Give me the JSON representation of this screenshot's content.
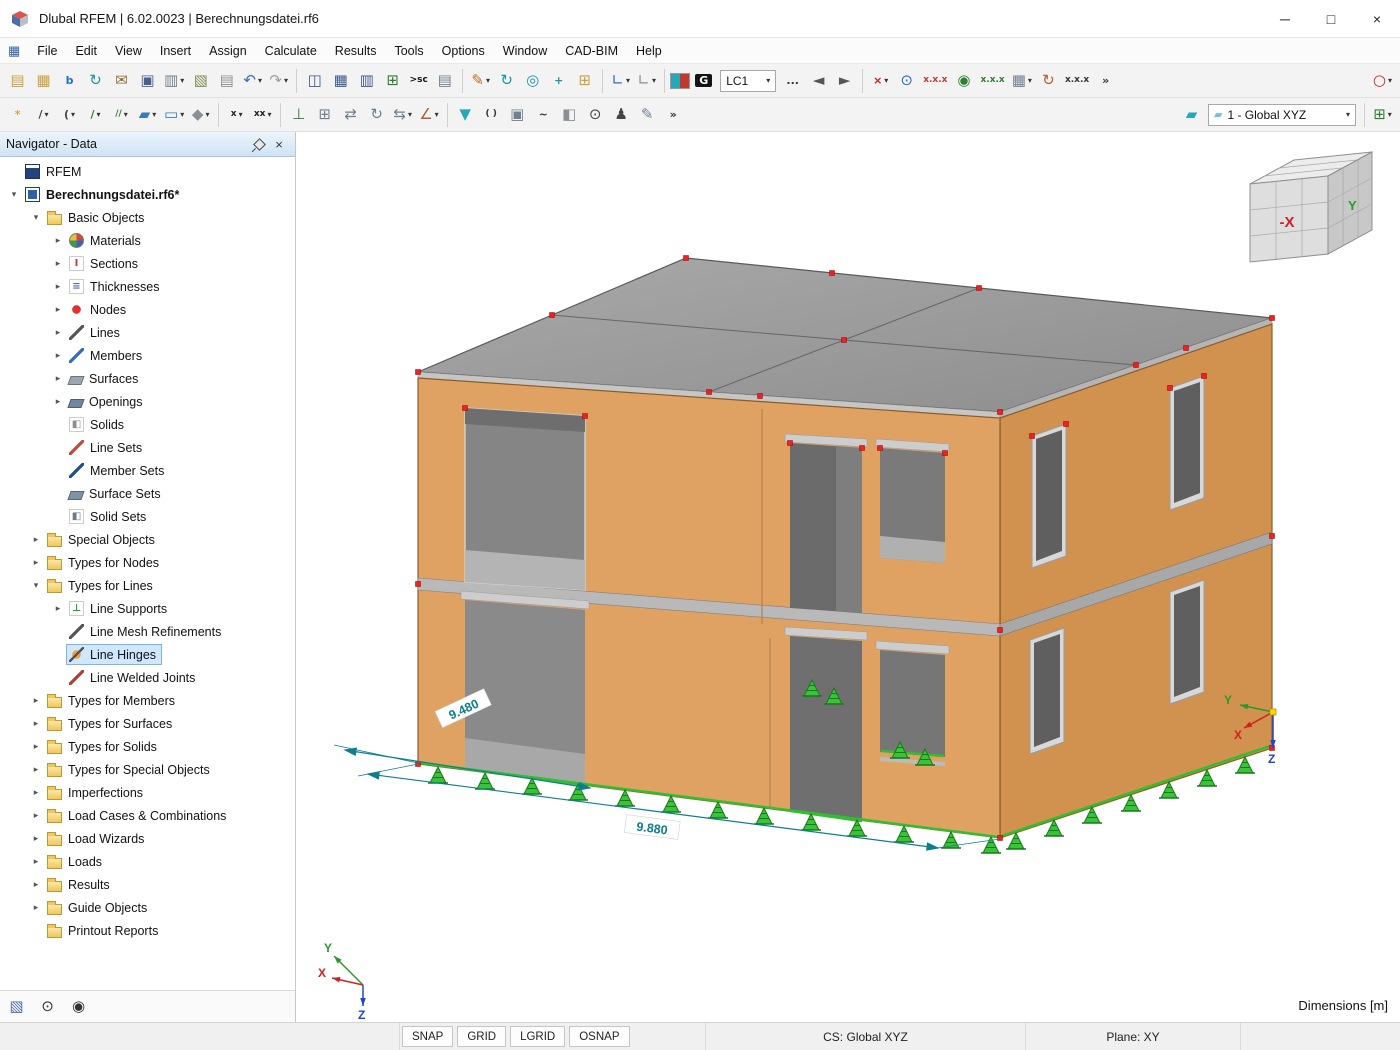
{
  "ui": {
    "caret": "▾",
    "chevron_right": "▸",
    "chevron_down": "▾"
  },
  "window": {
    "title": "Dlubal RFEM | 6.02.0023 | Berechnungsdatei.rf6",
    "minimize": "─",
    "maximize": "□",
    "close": "×"
  },
  "menu": {
    "items": [
      "File",
      "Edit",
      "View",
      "Insert",
      "Assign",
      "Calculate",
      "Results",
      "Tools",
      "Options",
      "Window",
      "CAD-BIM",
      "Help"
    ]
  },
  "toolbar1": {
    "items": [
      {
        "name": "new-model-button",
        "glyph": "▤",
        "color": "#c9a23d"
      },
      {
        "name": "open-model-button",
        "glyph": "▦",
        "color": "#c9a23d"
      },
      {
        "name": "bim-link-button",
        "glyph": "b",
        "text": true,
        "color": "#1f6fd0",
        "bold": true
      },
      {
        "name": "refresh-model-button",
        "glyph": "↻",
        "color": "#1b94a8"
      },
      {
        "name": "send-model-button",
        "glyph": "✉",
        "color": "#8a6d2f"
      },
      {
        "name": "save-button",
        "glyph": "▣",
        "color": "#47618f"
      },
      {
        "name": "print-button",
        "glyph": "▥",
        "color": "#6f7f8f",
        "caret": true
      },
      {
        "name": "export-report-button",
        "glyph": "▧",
        "color": "#7b8c4a"
      },
      {
        "name": "printout-report-button",
        "glyph": "▤",
        "color": "#8a8f96"
      },
      {
        "name": "undo-button",
        "glyph": "↶",
        "color": "#2f6fbf",
        "caret": true
      },
      {
        "name": "redo-button",
        "glyph": "↷",
        "color": "#9aa0a6",
        "caret": true
      },
      {
        "sep": true
      },
      {
        "name": "navigator-toggle-button",
        "glyph": "◫",
        "color": "#3a5a8c"
      },
      {
        "name": "tables-toggle-button",
        "glyph": "▦",
        "color": "#3a5a8c"
      },
      {
        "name": "table-view-button",
        "glyph": "▥",
        "color": "#3a5a8c"
      },
      {
        "name": "export-spreadsheet-button",
        "glyph": "⊞",
        "color": "#2e7d32"
      },
      {
        "name": "sc-export-button",
        "glyph": ">sc",
        "text": true,
        "small": true,
        "color": "#111"
      },
      {
        "name": "table-print-button",
        "glyph": "▤",
        "color": "#6f7f8f"
      },
      {
        "sep": true
      },
      {
        "name": "edit-objects-button",
        "glyph": "✎",
        "color": "#c06a20",
        "caret": true
      },
      {
        "name": "rotate-view-button",
        "glyph": "↻",
        "color": "#1b94a8"
      },
      {
        "name": "zoom-view-button",
        "glyph": "◎",
        "color": "#1b94a8"
      },
      {
        "name": "pan-view-button",
        "glyph": "+",
        "text": true,
        "color": "#1b94a8",
        "bold": true
      },
      {
        "name": "add-object-button",
        "glyph": "⊞",
        "color": "#c9a23d"
      },
      {
        "sep": true
      },
      {
        "name": "guideline-tool-button",
        "glyph": "∟",
        "color": "#2f6fbf",
        "caret": true
      },
      {
        "name": "grid-tool-button",
        "glyph": "∟",
        "color": "#8a8f96",
        "caret": true
      },
      {
        "sep": true
      },
      {
        "name": "render-colors-swatch",
        "kind": "swatch",
        "colors": [
          "#28a7b8",
          "#c03a2b"
        ]
      },
      {
        "name": "self-weight-button",
        "glyph": "G",
        "text": true,
        "color": "#ffffff",
        "bg": "#141414"
      },
      {
        "name": "load-case-select",
        "kind": "combo",
        "value": "LC1",
        "width": 56
      },
      {
        "name": "load-case-browse-button",
        "glyph": "...",
        "text": true,
        "color": "#333"
      },
      {
        "name": "previous-load-case-button",
        "glyph": "◄",
        "color": "#555"
      },
      {
        "name": "next-load-case-button",
        "glyph": "►",
        "color": "#555"
      },
      {
        "sep": true
      },
      {
        "name": "delete-results-button",
        "glyph": "×",
        "text": true,
        "color": "#c22222",
        "bold": true,
        "caret": true
      },
      {
        "name": "results-display-button",
        "glyph": "⊙",
        "color": "#2f6fbf"
      },
      {
        "name": "numbering-display-button",
        "glyph": "x.x.x",
        "text": true,
        "small": true,
        "color": "#c03a2b"
      },
      {
        "name": "values-display-button",
        "glyph": "◉",
        "color": "#2e7d32"
      },
      {
        "name": "value-numbering-button",
        "glyph": "x.x.x",
        "text": true,
        "small": true,
        "color": "#2e7d32"
      },
      {
        "name": "display-settings-button",
        "glyph": "▦",
        "color": "#6f7f8f",
        "caret": true
      },
      {
        "name": "regenerate-button",
        "glyph": "↻",
        "color": "#b06030"
      },
      {
        "name": "unit-settings-button",
        "glyph": "x.x.x",
        "text": true,
        "small": true,
        "color": "#333"
      },
      {
        "name": "more-standard-tools-button",
        "glyph": "»",
        "text": true,
        "color": "#333"
      },
      {
        "spacer": true
      },
      {
        "name": "zoom-select-button",
        "glyph": "○",
        "color": "#c22222",
        "bold": true,
        "caret": true
      }
    ]
  },
  "toolbar2": {
    "items": [
      {
        "name": "new-node-button",
        "glyph": "*",
        "text": true,
        "color": "#d9a43c",
        "bold": true
      },
      {
        "name": "new-line-button",
        "glyph": "/",
        "text": true,
        "color": "#444",
        "caret": true
      },
      {
        "name": "new-arc-button",
        "glyph": "(",
        "text": true,
        "color": "#444",
        "caret": true
      },
      {
        "name": "new-member-button",
        "glyph": "/",
        "text": true,
        "color": "#2e7d32",
        "caret": true
      },
      {
        "name": "new-member-set-button",
        "glyph": "//",
        "text": true,
        "small": true,
        "color": "#2e7d32",
        "caret": true
      },
      {
        "name": "new-surface-button",
        "glyph": "▰",
        "color": "#3a7ab8",
        "caret": true
      },
      {
        "name": "new-opening-button",
        "glyph": "▭",
        "color": "#3a7ab8",
        "caret": true
      },
      {
        "name": "new-solid-button",
        "glyph": "◆",
        "color": "#8a8f96",
        "caret": true
      },
      {
        "sep": true
      },
      {
        "name": "dimension-tool-button",
        "glyph": "x",
        "text": true,
        "small": true,
        "color": "#222",
        "caret": true
      },
      {
        "name": "dimension-chain-button",
        "glyph": "xx",
        "text": true,
        "small": true,
        "color": "#222",
        "caret": true
      },
      {
        "sep": true
      },
      {
        "name": "new-node-support-button",
        "glyph": "⊥",
        "color": "#2e7d32"
      },
      {
        "name": "copy-array-button",
        "glyph": "⊞",
        "color": "#6f7f8f"
      },
      {
        "name": "move-button",
        "glyph": "⇄",
        "color": "#6f7f8f"
      },
      {
        "name": "rotate-button",
        "glyph": "↻",
        "color": "#6f7f8f"
      },
      {
        "name": "mirror-button",
        "glyph": "⇆",
        "color": "#6f7f8f",
        "caret": true
      },
      {
        "name": "new-hinge-button",
        "glyph": "∠",
        "color": "#b06030",
        "caret": true
      },
      {
        "sep": true
      },
      {
        "name": "selection-filter-button",
        "glyph": "▼",
        "color": "#28a7b8"
      },
      {
        "name": "clipping-planes-button",
        "glyph": "( )",
        "text": true,
        "small": true,
        "color": "#333"
      },
      {
        "name": "animation-button",
        "glyph": "▣",
        "color": "#6f7f8f"
      },
      {
        "name": "relaxation-button",
        "glyph": "~",
        "text": true,
        "color": "#333",
        "bold": true
      },
      {
        "name": "rendering-button",
        "glyph": "◧",
        "color": "#8a8f96"
      },
      {
        "name": "camera-button",
        "glyph": "⊙",
        "color": "#444"
      },
      {
        "name": "walk-through-button",
        "glyph": "♟",
        "color": "#444"
      },
      {
        "name": "sketch-mode-button",
        "glyph": "✎",
        "color": "#6f7f8f"
      },
      {
        "name": "more-insert-tools-button",
        "glyph": "»",
        "text": true,
        "color": "#333"
      },
      {
        "spacer": true
      },
      {
        "name": "work-plane-button",
        "glyph": "▰",
        "color": "#28a7b8"
      },
      {
        "name": "coordinate-system-select",
        "kind": "combo",
        "value": "1 - Global XYZ",
        "width": 148,
        "icon": "▰",
        "iconColor": "#79c0d8"
      },
      {
        "sep": true
      },
      {
        "name": "grid-settings-button",
        "glyph": "⊞",
        "color": "#2e7d32",
        "caret": true
      }
    ]
  },
  "navigator": {
    "title": "Navigator - Data",
    "close_glyph": "×",
    "tree": [
      {
        "label": "RFEM",
        "level": 0,
        "chevron": "none",
        "icon": "rfem-app-icon",
        "style": "app"
      },
      {
        "label": "Berechnungsdatei.rf6*",
        "level": 0,
        "chevron": "down",
        "icon": "model-file-icon",
        "style": "file",
        "bold": true
      },
      {
        "label": "Basic Objects",
        "level": 1,
        "chevron": "down",
        "icon": "folder-icon",
        "style": "folder"
      },
      {
        "label": "Materials",
        "level": 2,
        "chevron": "right",
        "icon": "materials-icon",
        "style": "pie"
      },
      {
        "label": "Sections",
        "level": 2,
        "chevron": "right",
        "icon": "sections-icon",
        "style": "glyph",
        "char": "I",
        "color": "#c23b22"
      },
      {
        "label": "Thicknesses",
        "level": 2,
        "chevron": "right",
        "icon": "thicknesses-icon",
        "style": "glyph",
        "char": "≡",
        "color": "#4a6fa5"
      },
      {
        "label": "Nodes",
        "level": 2,
        "chevron": "right",
        "icon": "nodes-icon",
        "style": "dot"
      },
      {
        "label": "Lines",
        "level": 2,
        "chevron": "right",
        "icon": "lines-icon",
        "style": "diag",
        "color": "#555555"
      },
      {
        "label": "Members",
        "level": 2,
        "chevron": "right",
        "icon": "members-icon",
        "style": "diag",
        "color": "#2f6fbf"
      },
      {
        "label": "Surfaces",
        "level": 2,
        "chevron": "right",
        "icon": "surfaces-icon",
        "style": "para",
        "color": "#9aa7b0"
      },
      {
        "label": "Openings",
        "level": 2,
        "chevron": "right",
        "icon": "openings-icon",
        "style": "para",
        "color": "#6f87a0"
      },
      {
        "label": "Solids",
        "level": 2,
        "chevron": "none",
        "icon": "solids-icon",
        "style": "glyph",
        "char": "◧",
        "color": "#8a8f96"
      },
      {
        "label": "Line Sets",
        "level": 2,
        "chevron": "none",
        "icon": "line-sets-icon",
        "style": "diag",
        "color": "#c24b3a"
      },
      {
        "label": "Member Sets",
        "level": 2,
        "chevron": "none",
        "icon": "member-sets-icon",
        "style": "diag",
        "color": "#1f4e8c"
      },
      {
        "label": "Surface Sets",
        "level": 2,
        "chevron": "none",
        "icon": "surface-sets-icon",
        "style": "para",
        "color": "#7f93a8"
      },
      {
        "label": "Solid Sets",
        "level": 2,
        "chevron": "none",
        "icon": "solid-sets-icon",
        "style": "glyph",
        "char": "◧",
        "color": "#6e7a86"
      },
      {
        "label": "Special Objects",
        "level": 1,
        "chevron": "right",
        "icon": "folder-icon",
        "style": "folder"
      },
      {
        "label": "Types for Nodes",
        "level": 1,
        "chevron": "right",
        "icon": "folder-icon",
        "style": "folder"
      },
      {
        "label": "Types for Lines",
        "level": 1,
        "chevron": "down",
        "icon": "folder-icon",
        "style": "folder"
      },
      {
        "label": "Line Supports",
        "level": 2,
        "chevron": "right",
        "icon": "line-supports-icon",
        "style": "glyph",
        "char": "⊥",
        "color": "#2a9a2a"
      },
      {
        "label": "Line Mesh Refinements",
        "level": 2,
        "chevron": "none",
        "icon": "line-mesh-refinements-icon",
        "style": "diag",
        "color": "#555555"
      },
      {
        "label": "Line Hinges",
        "level": 2,
        "chevron": "none",
        "icon": "line-hinges-icon",
        "style": "hinge",
        "selected": true
      },
      {
        "label": "Line Welded Joints",
        "level": 2,
        "chevron": "none",
        "icon": "line-welded-joints-icon",
        "style": "diag",
        "color": "#b04030"
      },
      {
        "label": "Types for Members",
        "level": 1,
        "chevron": "right",
        "icon": "folder-icon",
        "style": "folder"
      },
      {
        "label": "Types for Surfaces",
        "level": 1,
        "chevron": "right",
        "icon": "folder-icon",
        "style": "folder"
      },
      {
        "label": "Types for Solids",
        "level": 1,
        "chevron": "right",
        "icon": "folder-icon",
        "style": "folder"
      },
      {
        "label": "Types for Special Objects",
        "level": 1,
        "chevron": "right",
        "icon": "folder-icon",
        "style": "folder"
      },
      {
        "label": "Imperfections",
        "level": 1,
        "chevron": "right",
        "icon": "folder-icon",
        "style": "folder"
      },
      {
        "label": "Load Cases & Combinations",
        "level": 1,
        "chevron": "right",
        "icon": "folder-icon",
        "style": "folder"
      },
      {
        "label": "Load Wizards",
        "level": 1,
        "chevron": "right",
        "icon": "folder-icon",
        "style": "folder"
      },
      {
        "label": "Loads",
        "level": 1,
        "chevron": "right",
        "icon": "folder-icon",
        "style": "folder"
      },
      {
        "label": "Results",
        "level": 1,
        "chevron": "right",
        "icon": "folder-icon",
        "style": "folder"
      },
      {
        "label": "Guide Objects",
        "level": 1,
        "chevron": "right",
        "icon": "folder-icon",
        "style": "folder"
      },
      {
        "label": "Printout Reports",
        "level": 1,
        "chevron": "none",
        "icon": "folder-icon",
        "style": "folder"
      }
    ],
    "footer": [
      {
        "name": "print-graphic-button",
        "glyph": "▧",
        "color": "#4a6fa5"
      },
      {
        "name": "visibility-eye-button",
        "glyph": "⊙",
        "color": "#333"
      },
      {
        "name": "camera-view-button",
        "glyph": "◉",
        "color": "#333"
      }
    ]
  },
  "viewport": {
    "dim_depth_label": "9.480",
    "dim_width_label": "9.880",
    "origin_axes": {
      "x": "X",
      "y": "Y",
      "z": "Z"
    },
    "ucs_axes": {
      "x": "X",
      "y": "Y",
      "z": "Z"
    },
    "nav_cube": {
      "front": "-X",
      "right": "Y"
    }
  },
  "statusbar": {
    "snap": "SNAP",
    "grid": "GRID",
    "lgrid": "LGRID",
    "osnap": "OSNAP",
    "cs": "CS: Global XYZ",
    "plane": "Plane: XY"
  },
  "dimensions_label": "Dimensions [m]"
}
